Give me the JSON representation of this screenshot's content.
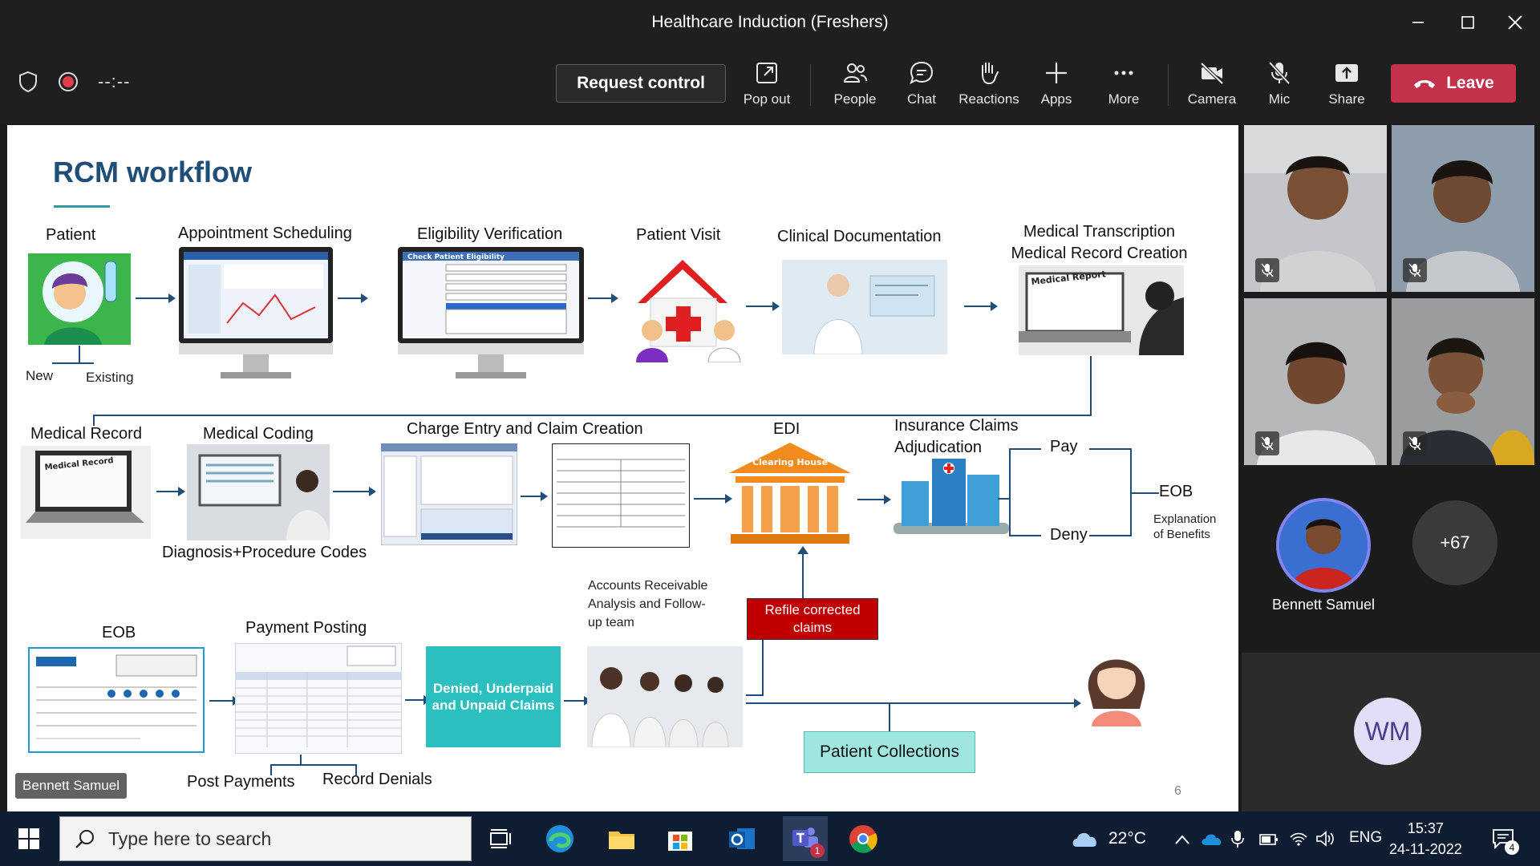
{
  "window": {
    "title": "Healthcare Induction (Freshers)"
  },
  "toolbar": {
    "timer": "--:--",
    "request_control": "Request control",
    "pop_out": "Pop out",
    "people": "People",
    "chat": "Chat",
    "reactions": "Reactions",
    "apps": "Apps",
    "more": "More",
    "camera": "Camera",
    "mic": "Mic",
    "share": "Share",
    "leave": "Leave"
  },
  "slide": {
    "title": "RCM workflow",
    "row1": {
      "patient": "Patient",
      "new": "New",
      "existing": "Existing",
      "appointment": "Appointment Scheduling",
      "eligibility": "Eligibility Verification",
      "patient_visit": "Patient Visit",
      "clinical_doc": "Clinical Documentation",
      "transcription_1": "Medical Transcription",
      "transcription_2": "Medical Record Creation"
    },
    "row2": {
      "medical_record": "Medical Record",
      "medical_coding": "Medical Coding",
      "diag_codes": "Diagnosis+Procedure Codes",
      "charge_entry": "Charge Entry and Claim Creation",
      "edi": "EDI",
      "clearing_house": "Clearing House",
      "adjudication_1": "Insurance Claims",
      "adjudication_2": "Adjudication",
      "pay": "Pay",
      "deny": "Deny",
      "eob": "EOB",
      "eob_sub_1": "Explanation",
      "eob_sub_2": "of Benefits"
    },
    "row3": {
      "eob": "EOB",
      "payment_posting": "Payment Posting",
      "post_payments": "Post Payments",
      "record_denials": "Record Denials",
      "denied_box": "Denied, Underpaid and Unpaid Claims",
      "ar_1": "Accounts Receivable",
      "ar_2": "Analysis and Follow-",
      "ar_3": "up team",
      "refile": "Refile corrected claims",
      "patient_collections": "Patient Collections"
    },
    "presenter_tag": "Bennett Samuel",
    "page_number": "6",
    "eligibility_screen_header": "Check Patient Eligibility",
    "medical_report_label": "Medical Report",
    "medical_record_label": "Medical Record"
  },
  "participants": {
    "featured_name": "Bennett Samuel",
    "overflow_count": "+67",
    "initials": "WM"
  },
  "taskbar": {
    "search_placeholder": "Type here to search",
    "weather": "22°C",
    "language": "ENG",
    "time": "15:37",
    "date": "24-11-2022",
    "teams_badge": "1",
    "notifications": "4"
  },
  "colors": {
    "leave": "#c4314b",
    "slide_title": "#1f4e79",
    "arrow": "#1f4e79",
    "refile_box": "#c00000",
    "denied_box": "#2bbfbf",
    "collections_box": "#9ee6df",
    "avatar_ring": "#7f85f5"
  }
}
